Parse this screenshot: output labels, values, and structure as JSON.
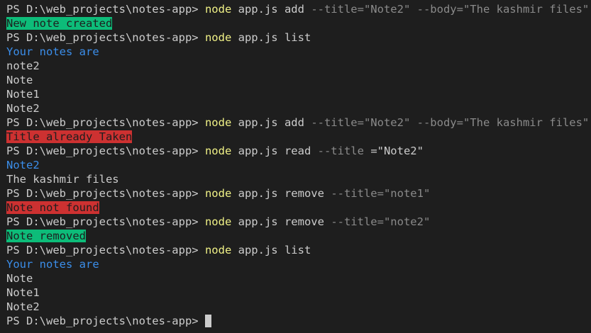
{
  "terminal": {
    "prompt": "PS D:\\web_projects\\notes-app> ",
    "cmd_word": "node",
    "lines": {
      "l1": {
        "a": "app.js add",
        "f1": "--title=\"Note2\"",
        "f2": "--body=\"The kashmir files\""
      },
      "l2": {
        "text": "New note created"
      },
      "l3": {
        "a": "app.js list"
      },
      "l4": {
        "text": "Your notes are"
      },
      "l5": {
        "text": "note2"
      },
      "l6": {
        "text": "Note"
      },
      "l7": {
        "text": "Note1"
      },
      "l8": {
        "text": "Note2"
      },
      "l9": {
        "a": "app.js add",
        "f1": "--title=\"Note2\"",
        "f2": "--body=\"The kashmir files\""
      },
      "l10": {
        "text": "Title already Taken"
      },
      "l11": {
        "a": "app.js read",
        "f1": "--title",
        "v": "=\"Note2\""
      },
      "l12": {
        "text": "Note2"
      },
      "l13": {
        "text": "The kashmir files"
      },
      "l14": {
        "a": "app.js remove",
        "f1": "--title=\"note1\""
      },
      "l15": {
        "text": "Note not found"
      },
      "l16": {
        "a": "app.js remove",
        "f1": "--title=\"note2\""
      },
      "l17": {
        "text": "Note removed"
      },
      "l18": {
        "a": "app.js list"
      },
      "l19": {
        "text": "Your notes are"
      },
      "l20": {
        "text": "Note"
      },
      "l21": {
        "text": "Note1"
      },
      "l22": {
        "text": "Note2"
      }
    }
  },
  "colors": {
    "background": "#1e1e1e",
    "command": "#f1f287",
    "info_blue": "#3b8eea",
    "success_bg": "#0dbc79",
    "error_bg": "#cd3131"
  }
}
